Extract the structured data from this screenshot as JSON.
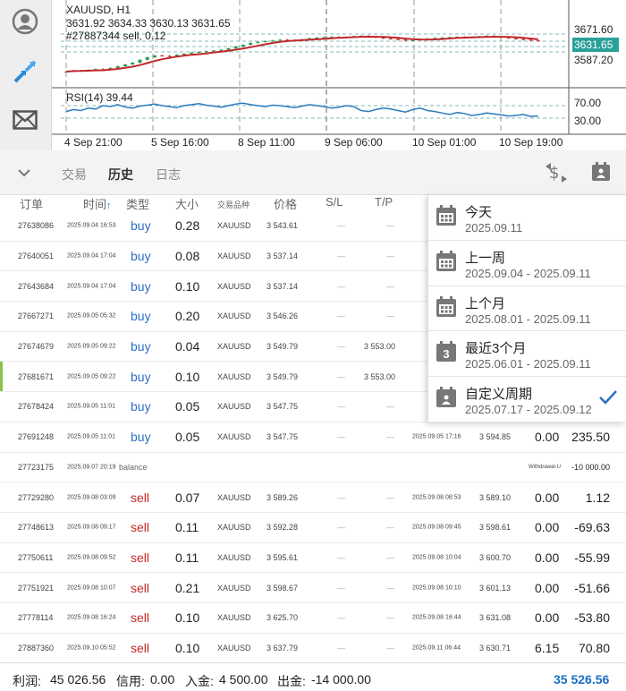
{
  "chart": {
    "symbol": "XAUUSD, H1",
    "ohlc": "3631.92 3634.33 3630.13 3631.65",
    "order_label": "#27887344 sell, 0.12",
    "price_levels": [
      "3671.60",
      "3631.65",
      "3587.20"
    ],
    "rsi_label": "RSI(14) 39.44",
    "rsi_levels": [
      "70.00",
      "30.00"
    ],
    "time_labels": [
      "4 Sep 21:00",
      "5 Sep 16:00",
      "8 Sep 11:00",
      "9 Sep 06:00",
      "10 Sep 01:00",
      "10 Sep 19:00"
    ]
  },
  "toolbar": {
    "tabs": [
      {
        "label": "交易",
        "active": false
      },
      {
        "label": "历史",
        "active": true
      },
      {
        "label": "日志",
        "active": false
      }
    ]
  },
  "table": {
    "headers": {
      "order": "订单",
      "time": "时间",
      "type": "类型",
      "size": "大小",
      "symbol": "交易品种",
      "price": "价格",
      "sl": "S/L",
      "tp": "T/P"
    },
    "rows": [
      {
        "order": "27638086",
        "time": "2025.09.04 16:53",
        "type": "buy",
        "size": "0.28",
        "symbol": "XAUUSD",
        "price": "3 543.61",
        "sl": "—",
        "tp": "—",
        "close_time": "",
        "close_price": "",
        "swap": "",
        "profit": ""
      },
      {
        "order": "27640051",
        "time": "2025.09.04 17:04",
        "type": "buy",
        "size": "0.08",
        "symbol": "XAUUSD",
        "price": "3 537.14",
        "sl": "—",
        "tp": "—",
        "close_time": "",
        "close_price": "",
        "swap": "",
        "profit": ""
      },
      {
        "order": "27643684",
        "time": "2025.09.04 17:04",
        "type": "buy",
        "size": "0.10",
        "symbol": "XAUUSD",
        "price": "3 537.14",
        "sl": "—",
        "tp": "—",
        "close_time": "",
        "close_price": "",
        "swap": "",
        "profit": ""
      },
      {
        "order": "27667271",
        "time": "2025.09.05 05:32",
        "type": "buy",
        "size": "0.20",
        "symbol": "XAUUSD",
        "price": "3 546.26",
        "sl": "—",
        "tp": "—",
        "close_time": "",
        "close_price": "",
        "swap": "",
        "profit": ""
      },
      {
        "order": "27674679",
        "time": "2025.09.05 09:22",
        "type": "buy",
        "size": "0.04",
        "symbol": "XAUUSD",
        "price": "3 549.79",
        "sl": "—",
        "tp": "3 553.00",
        "close_time": "",
        "close_price": "",
        "swap": "",
        "profit": ""
      },
      {
        "order": "27681671",
        "time": "2025.09.05 09:22",
        "type": "buy",
        "size": "0.10",
        "symbol": "XAUUSD",
        "price": "3 549.79",
        "sl": "—",
        "tp": "3 553.00",
        "close_time": "",
        "close_price": "",
        "swap": "",
        "profit": "",
        "marked": true
      },
      {
        "order": "27678424",
        "time": "2025.09.05 11:01",
        "type": "buy",
        "size": "0.05",
        "symbol": "XAUUSD",
        "price": "3 547.75",
        "sl": "—",
        "tp": "—",
        "close_time": "",
        "close_price": "",
        "swap": "",
        "profit": ""
      },
      {
        "order": "27691248",
        "time": "2025.09.05 11:01",
        "type": "buy",
        "size": "0.05",
        "symbol": "XAUUSD",
        "price": "3 547.75",
        "sl": "—",
        "tp": "—",
        "close_time": "2025.09.05 17:16",
        "close_price": "3 594.85",
        "swap": "0.00",
        "profit": "235.50"
      },
      {
        "order": "27723175",
        "time": "2025.09.07 20:19",
        "type": "balance",
        "size": "",
        "symbol": "",
        "price": "",
        "sl": "",
        "tp": "",
        "close_time": "",
        "close_price": "Withdrawal-U",
        "swap": "",
        "profit": "-10 000.00"
      },
      {
        "order": "27729280",
        "time": "2025.09.08 03:09",
        "type": "sell",
        "size": "0.07",
        "symbol": "XAUUSD",
        "price": "3 589.26",
        "sl": "—",
        "tp": "—",
        "close_time": "2025.09.08 08:53",
        "close_price": "3 589.10",
        "swap": "0.00",
        "profit": "1.12"
      },
      {
        "order": "27748613",
        "time": "2025.09.08 09:17",
        "type": "sell",
        "size": "0.11",
        "symbol": "XAUUSD",
        "price": "3 592.28",
        "sl": "—",
        "tp": "—",
        "close_time": "2025.09.08 09:45",
        "close_price": "3 598.61",
        "swap": "0.00",
        "profit": "-69.63"
      },
      {
        "order": "27750611",
        "time": "2025.09.08 09:52",
        "type": "sell",
        "size": "0.11",
        "symbol": "XAUUSD",
        "price": "3 595.61",
        "sl": "—",
        "tp": "—",
        "close_time": "2025.09.08 10:04",
        "close_price": "3 600.70",
        "swap": "0.00",
        "profit": "-55.99"
      },
      {
        "order": "27751921",
        "time": "2025.09.08 10:07",
        "type": "sell",
        "size": "0.21",
        "symbol": "XAUUSD",
        "price": "3 598.67",
        "sl": "—",
        "tp": "—",
        "close_time": "2025.09.08 10:10",
        "close_price": "3 601.13",
        "swap": "0.00",
        "profit": "-51.66"
      },
      {
        "order": "27778114",
        "time": "2025.09.08 16:24",
        "type": "sell",
        "size": "0.10",
        "symbol": "XAUUSD",
        "price": "3 625.70",
        "sl": "—",
        "tp": "—",
        "close_time": "2025.09.08 16:44",
        "close_price": "3 631.08",
        "swap": "0.00",
        "profit": "-53.80"
      },
      {
        "order": "27887360",
        "time": "2025.09.10 05:52",
        "type": "sell",
        "size": "0.10",
        "symbol": "XAUUSD",
        "price": "3 637.79",
        "sl": "—",
        "tp": "—",
        "close_time": "2025.09.11 06:44",
        "close_price": "3 630.71",
        "swap": "6.15",
        "profit": "70.80"
      }
    ]
  },
  "period_menu": {
    "items": [
      {
        "title": "今天",
        "dates": "2025.09.11",
        "badge": "",
        "selected": false
      },
      {
        "title": "上一周",
        "dates": "2025.09.04 - 2025.09.11",
        "badge": "",
        "selected": false
      },
      {
        "title": "上个月",
        "dates": "2025.08.01 - 2025.09.11",
        "badge": "",
        "selected": false
      },
      {
        "title": "最近3个月",
        "dates": "2025.06.01 - 2025.09.11",
        "badge": "3",
        "selected": false
      },
      {
        "title": "自定义周期",
        "dates": "2025.07.17 - 2025.09.12",
        "badge": "",
        "selected": true
      }
    ]
  },
  "footer": {
    "profit_label": "利润:",
    "profit_value": "45 026.56",
    "credit_label": "信用:",
    "credit_value": "0.00",
    "deposit_label": "入金:",
    "deposit_value": "4 500.00",
    "withdraw_label": "出金:",
    "withdraw_value": "-14 000.00",
    "balance": "35 526.56"
  },
  "colors": {
    "buy": "#2a6fc6",
    "sell": "#c62828",
    "accent": "#1a6ec4",
    "price_tag": "#2aa198",
    "candle_up": "#2e9e4e",
    "ma_line": "#c0282c",
    "rsi_line": "#2b7bbf"
  },
  "icons": {
    "rail": [
      "account-icon",
      "trade-arrows-icon",
      "mail-icon"
    ],
    "toolbar": [
      "chevron-down-icon",
      "currency-sort-icon",
      "calendar-icon"
    ],
    "check": "check-icon"
  }
}
